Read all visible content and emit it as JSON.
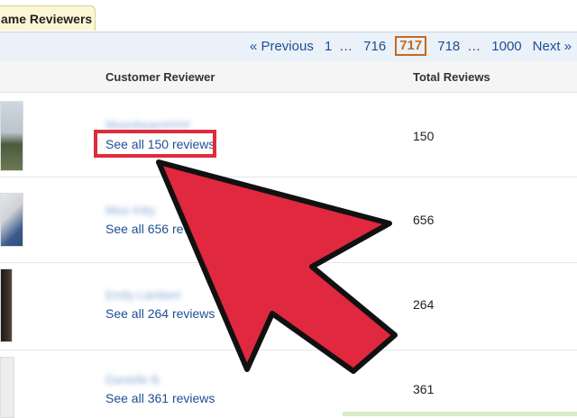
{
  "tab": {
    "label": "ame Reviewers"
  },
  "pager": {
    "previous": "« Previous",
    "first": "1",
    "ellipsis1": "…",
    "prev_page": "716",
    "current": "717",
    "next_page": "718",
    "ellipsis2": "…",
    "last": "1000",
    "next": "Next »"
  },
  "table": {
    "col_reviewer": "Customer Reviewer",
    "col_total": "Total Reviews",
    "rows": [
      {
        "name": "Moonbeam####",
        "see_all": "See all 150 reviews",
        "total": "150"
      },
      {
        "name": "Miss Kitty",
        "see_all": "See all 656 revie",
        "total": "656"
      },
      {
        "name": "Emily Lambert",
        "see_all": "See all 264 reviews",
        "total": "264"
      },
      {
        "name": "Danielle B.",
        "see_all": "See all 361 reviews",
        "total": "361"
      }
    ]
  },
  "colors": {
    "arrow": "#e0283e",
    "link": "#1e4f94",
    "current_page": "#c46a1f",
    "highlight": "#e02b3c"
  }
}
